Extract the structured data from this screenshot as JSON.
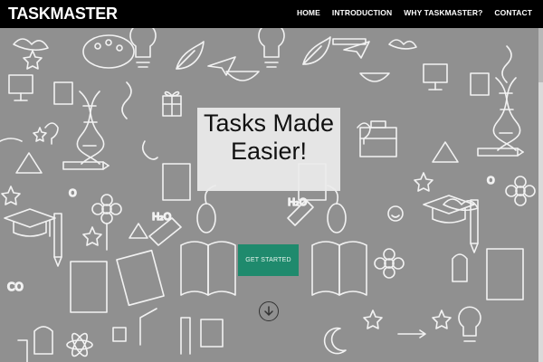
{
  "brand": "TASKMASTER",
  "nav": {
    "home": "HOME",
    "introduction": "INTRODUCTION",
    "why": "WHY TASKMASTER?",
    "contact": "CONTACT"
  },
  "hero": {
    "headline_line1": "Tasks Made",
    "headline_line2": "Easier!",
    "cta": "GET STARTED",
    "background_icons": [
      "lightbulb-icon",
      "dna-icon",
      "book-icon",
      "graduation-cap-icon",
      "star-icon",
      "leaf-icon",
      "flower-icon",
      "telescope-icon",
      "ruler-icon",
      "paper-plane-icon",
      "atom-icon",
      "moon-icon",
      "gift-icon",
      "briefcase-icon",
      "monitor-icon"
    ]
  },
  "colors": {
    "nav_bg": "#000000",
    "hero_bg": "#909090",
    "cta_bg": "#1f8a6d",
    "headline_box": "#ececec"
  }
}
